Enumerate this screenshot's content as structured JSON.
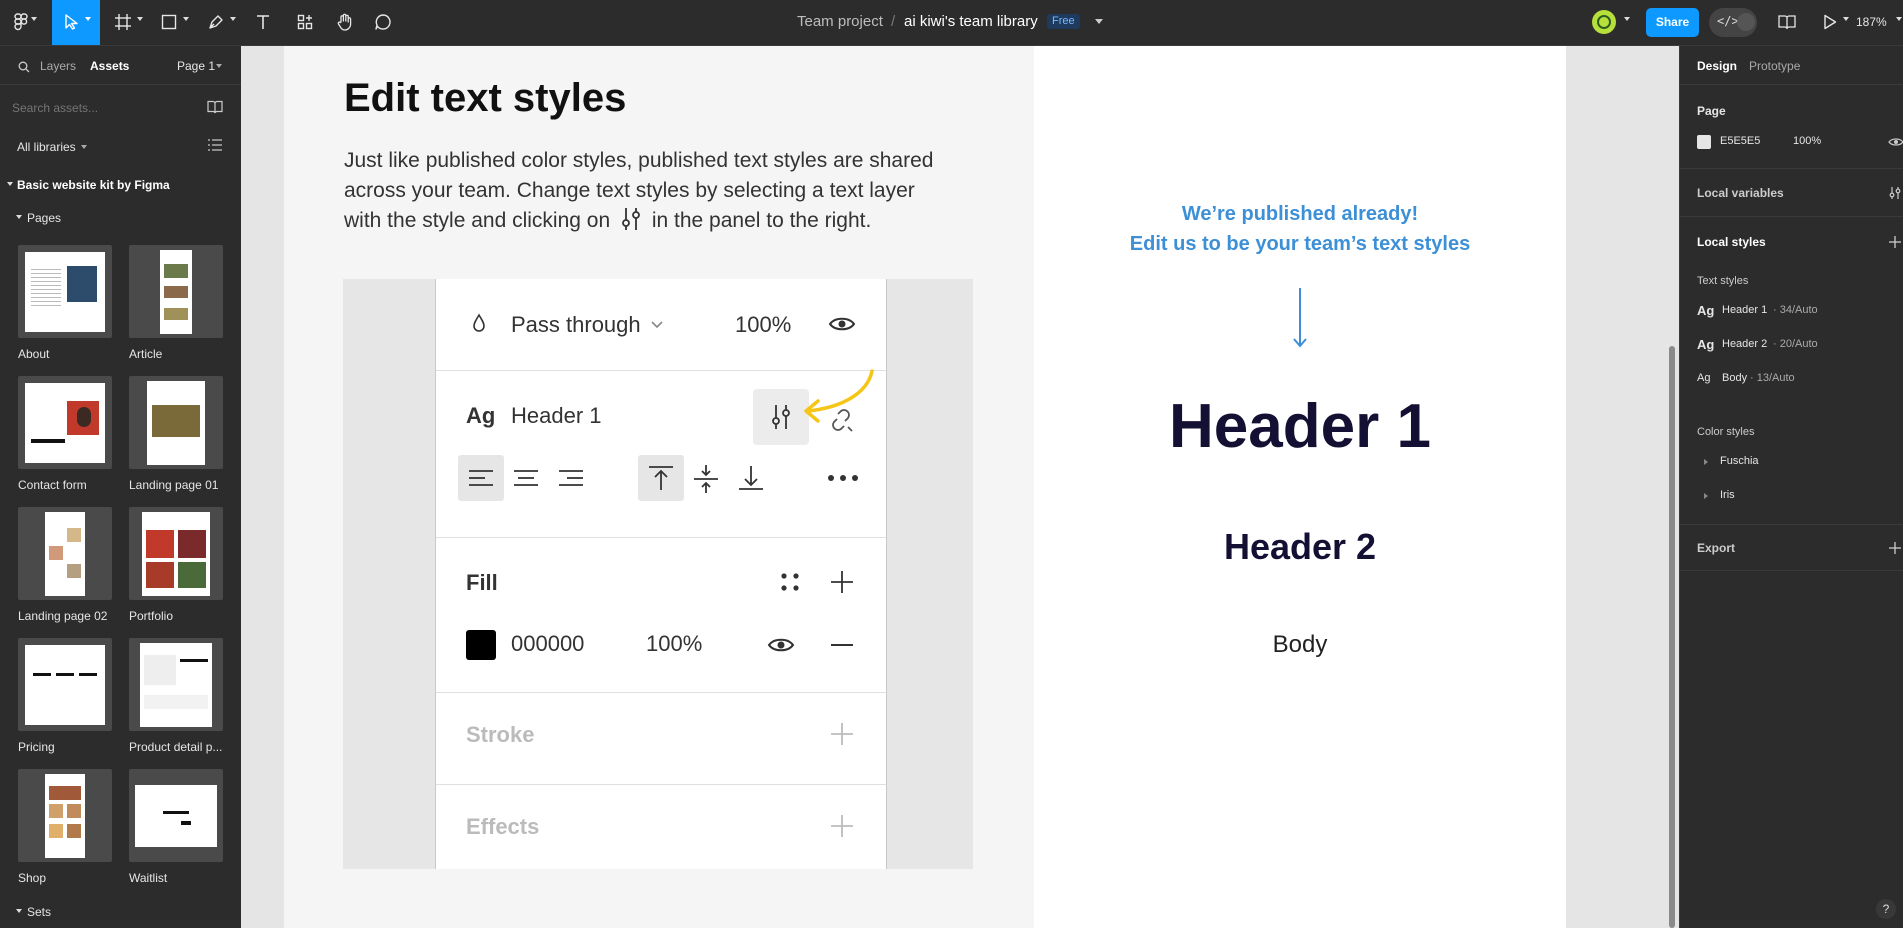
{
  "toolbar": {
    "breadcrumb_team": "Team project",
    "breadcrumb_sep": "/",
    "file_name": "ai kiwi's team library",
    "plan_badge": "Free",
    "share_label": "Share",
    "zoom": "187%"
  },
  "left_panel": {
    "tab_layers": "Layers",
    "tab_assets": "Assets",
    "page_selector": "Page 1",
    "search_placeholder": "Search assets...",
    "libraries": "All libraries",
    "library_name": "Basic website kit by Figma",
    "pages_heading": "Pages",
    "pages": [
      {
        "label": "About"
      },
      {
        "label": "Article"
      },
      {
        "label": "Contact form"
      },
      {
        "label": "Landing page 01"
      },
      {
        "label": "Landing page 02"
      },
      {
        "label": "Portfolio"
      },
      {
        "label": "Pricing"
      },
      {
        "label": "Product detail p..."
      },
      {
        "label": "Shop"
      },
      {
        "label": "Waitlist"
      }
    ],
    "sets_heading": "Sets"
  },
  "canvas": {
    "title": "Edit text styles",
    "desc_line1": "Just like published color styles, published text styles are shared",
    "desc_line2": "across your team. Change text styles by selecting a text layer",
    "desc_line3a": "with the style and clicking on",
    "desc_line3b": "in the panel to the right.",
    "mock": {
      "blend_mode": "Pass through",
      "layer_opacity": "100%",
      "ag": "Ag",
      "text_style": "Header 1",
      "fill_heading": "Fill",
      "fill_hex": "000000",
      "fill_opacity": "100%",
      "stroke_heading": "Stroke",
      "effects_heading": "Effects"
    },
    "published_line1": "We’re published already!",
    "published_line2": "Edit us to be your team’s text styles",
    "sample_h1": "Header 1",
    "sample_h2": "Header 2",
    "sample_body": "Body",
    "colors": {
      "accent_blue": "#3d8fd6",
      "navy": "#141033",
      "arrow_yellow": "#f5c518"
    }
  },
  "right_panel": {
    "tab_design": "Design",
    "tab_prototype": "Prototype",
    "page_heading": "Page",
    "page_color": "E5E5E5",
    "page_opacity": "100%",
    "local_variables": "Local variables",
    "local_styles": "Local styles",
    "text_styles_heading": "Text styles",
    "text_styles": [
      {
        "ag": "Ag",
        "name": "Header 1",
        "meta": "· 34/Auto"
      },
      {
        "ag": "Ag",
        "name": "Header 2",
        "meta": "· 20/Auto"
      },
      {
        "ag": "Ag",
        "name": "Body",
        "meta": "· 13/Auto"
      }
    ],
    "color_styles_heading": "Color styles",
    "color_styles": [
      {
        "name": "Fuschia"
      },
      {
        "name": "Iris"
      }
    ],
    "export": "Export",
    "help": "?"
  }
}
